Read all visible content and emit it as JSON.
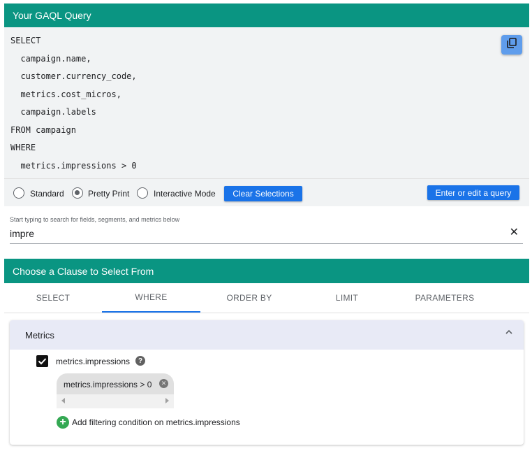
{
  "query_panel": {
    "title": "Your GAQL Query",
    "lines": [
      "SELECT",
      "  campaign.name,",
      "  customer.currency_code,",
      "  metrics.cost_micros,",
      "  campaign.labels",
      "FROM campaign",
      "WHERE",
      "  metrics.impressions > 0"
    ],
    "copy_icon": "copy-icon"
  },
  "modes": {
    "options": [
      "Standard",
      "Pretty Print",
      "Interactive Mode"
    ],
    "selected": "Pretty Print",
    "clear_label": "Clear Selections",
    "edit_label": "Enter or edit a query"
  },
  "search": {
    "hint": "Start typing to search for fields, segments, and metrics below",
    "value": "impre",
    "clear_icon": "close-icon"
  },
  "clause_panel": {
    "title": "Choose a Clause to Select From",
    "tabs": [
      "SELECT",
      "WHERE",
      "ORDER BY",
      "LIMIT",
      "PARAMETERS"
    ],
    "active_tab": "WHERE"
  },
  "metrics_section": {
    "title": "Metrics",
    "expanded": true,
    "field": "metrics.impressions",
    "checked": true,
    "help_glyph": "?",
    "condition_chip": "metrics.impressions > 0",
    "add_label": "Add filtering condition on metrics.impressions"
  },
  "colors": {
    "header_teal": "#0a9582",
    "primary_blue": "#1a73e8",
    "copy_button": "#5f9dec",
    "add_green": "#34a853"
  }
}
